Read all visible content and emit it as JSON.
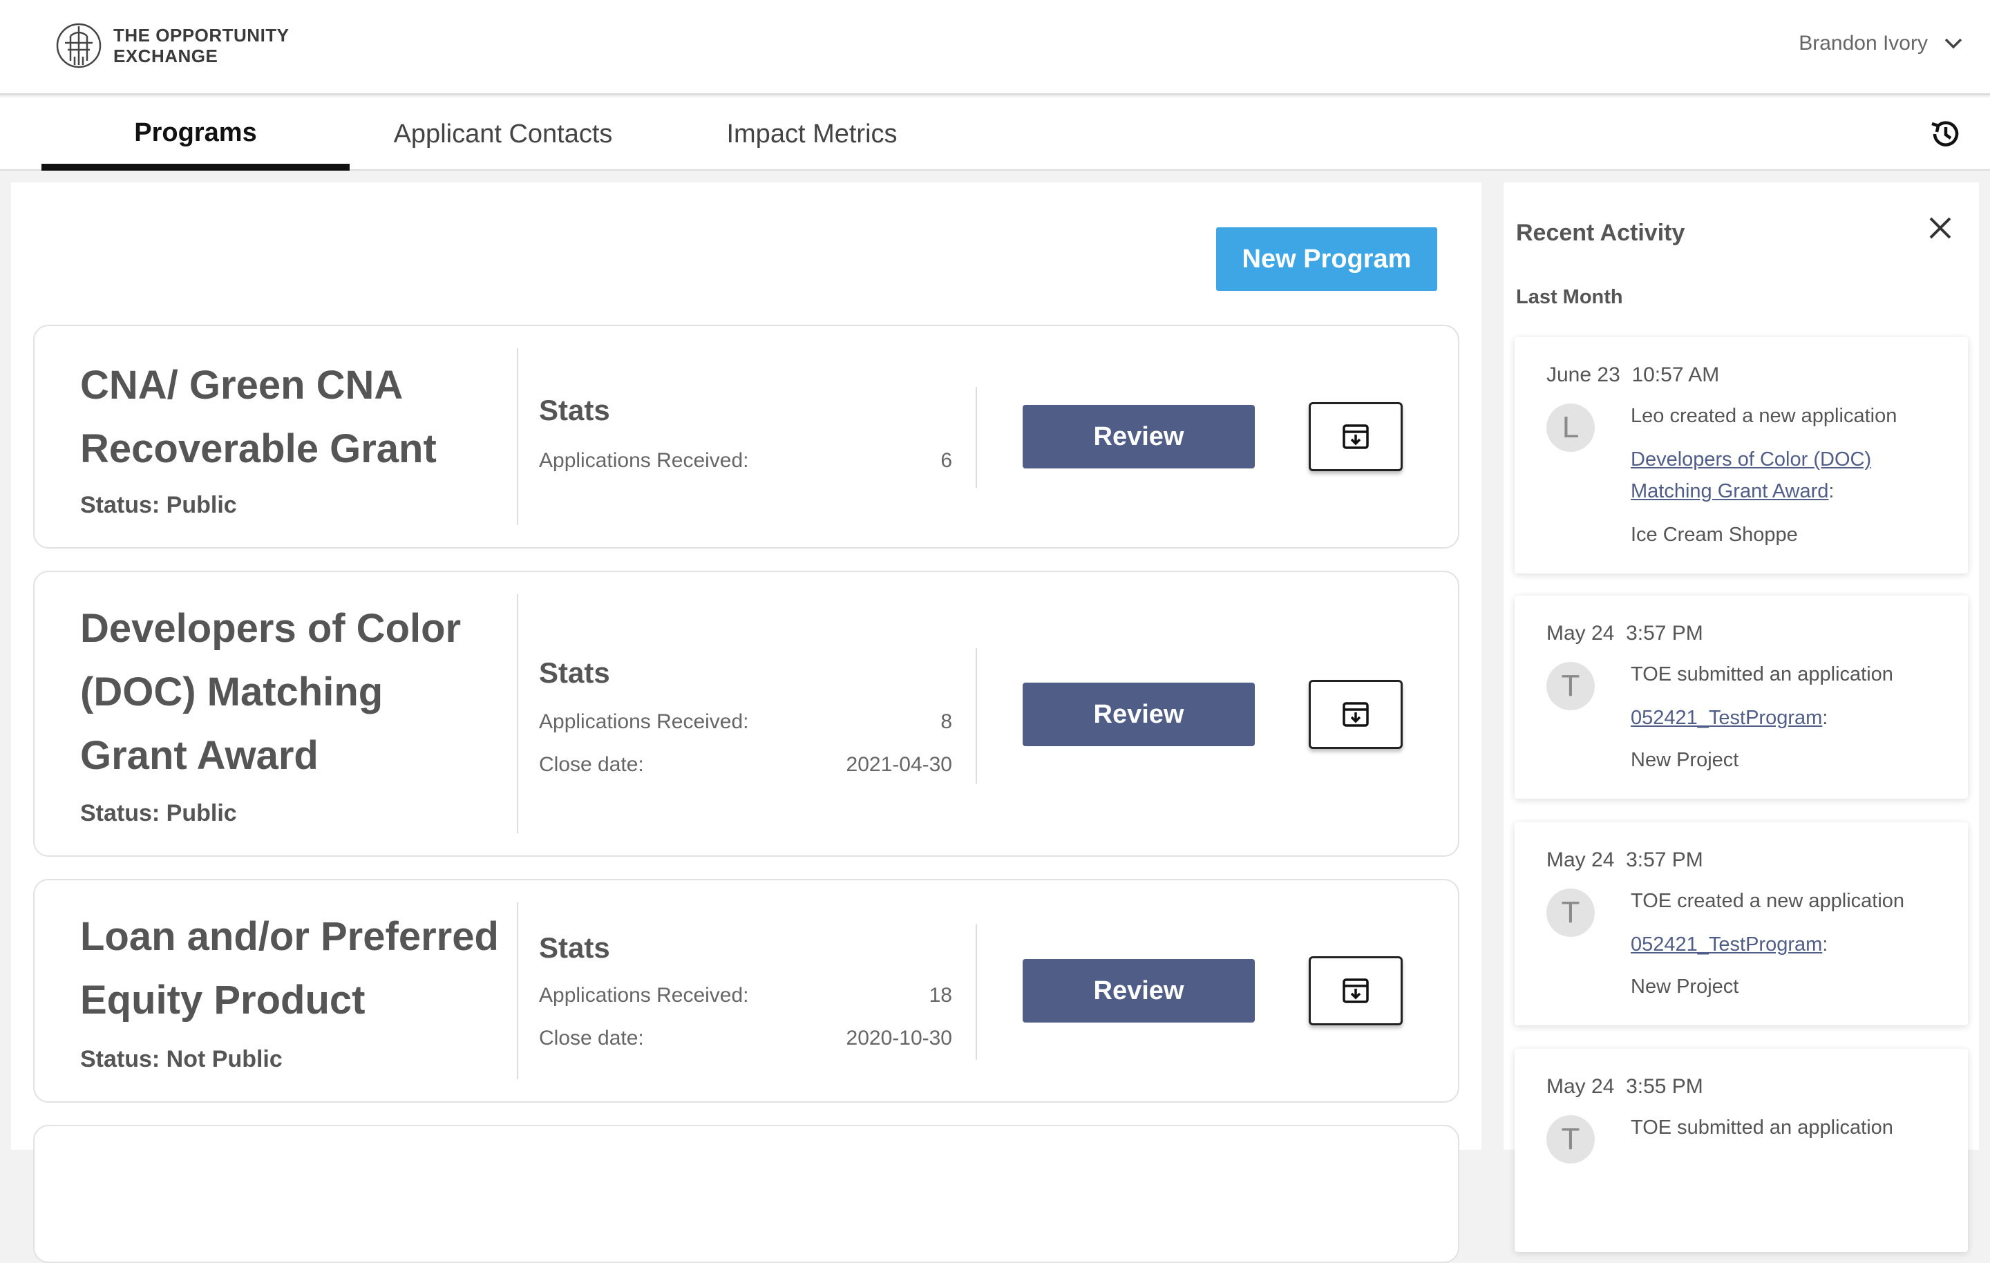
{
  "header": {
    "brand_line1": "THE OPPORTUNITY",
    "brand_line2": "EXCHANGE",
    "user_name": "Brandon Ivory"
  },
  "tabs": [
    {
      "label": "Programs",
      "active": true
    },
    {
      "label": "Applicant Contacts",
      "active": false
    },
    {
      "label": "Impact Metrics",
      "active": false
    }
  ],
  "main": {
    "new_program_label": "New Program",
    "programs": [
      {
        "title": "CNA/ Green CNA Recoverable Grant",
        "status": "Status: Public",
        "stats_title": "Stats",
        "applications_label": "Applications Received:",
        "applications_value": "6",
        "review_label": "Review"
      },
      {
        "title": "Developers of Color (DOC) Matching Grant Award",
        "status": "Status: Public",
        "stats_title": "Stats",
        "applications_label": "Applications Received:",
        "applications_value": "8",
        "close_label": "Close date:",
        "close_value": "2021-04-30",
        "review_label": "Review"
      },
      {
        "title": "Loan and/or Preferred Equity Product",
        "status": "Status: Not Public",
        "stats_title": "Stats",
        "applications_label": "Applications Received:",
        "applications_value": "18",
        "close_label": "Close date:",
        "close_value": "2020-10-30",
        "review_label": "Review"
      }
    ]
  },
  "activity": {
    "title": "Recent Activity",
    "section": "Last Month",
    "items": [
      {
        "date": "June 23",
        "time": "10:57 AM",
        "initial": "L",
        "text": "Leo created a new application",
        "link": "Developers of Color (DOC) Matching Grant Award",
        "project": "Ice Cream Shoppe"
      },
      {
        "date": "May 24",
        "time": "3:57 PM",
        "initial": "T",
        "text": "TOE submitted an application",
        "link": "052421_TestProgram",
        "project": "New Project"
      },
      {
        "date": "May 24",
        "time": "3:57 PM",
        "initial": "T",
        "text": "TOE created a new application",
        "link": "052421_TestProgram",
        "project": "New Project"
      },
      {
        "date": "May 24",
        "time": "3:55 PM",
        "initial": "T",
        "text": "TOE submitted an application"
      }
    ]
  },
  "colors": {
    "accent_blue": "#3fa6e6",
    "review_navy": "#4f5d87",
    "active_tab_underline": "#111111"
  },
  "icons": [
    "brand-logo-icon",
    "chevron-down-icon",
    "history-icon",
    "archive-icon",
    "close-icon"
  ]
}
